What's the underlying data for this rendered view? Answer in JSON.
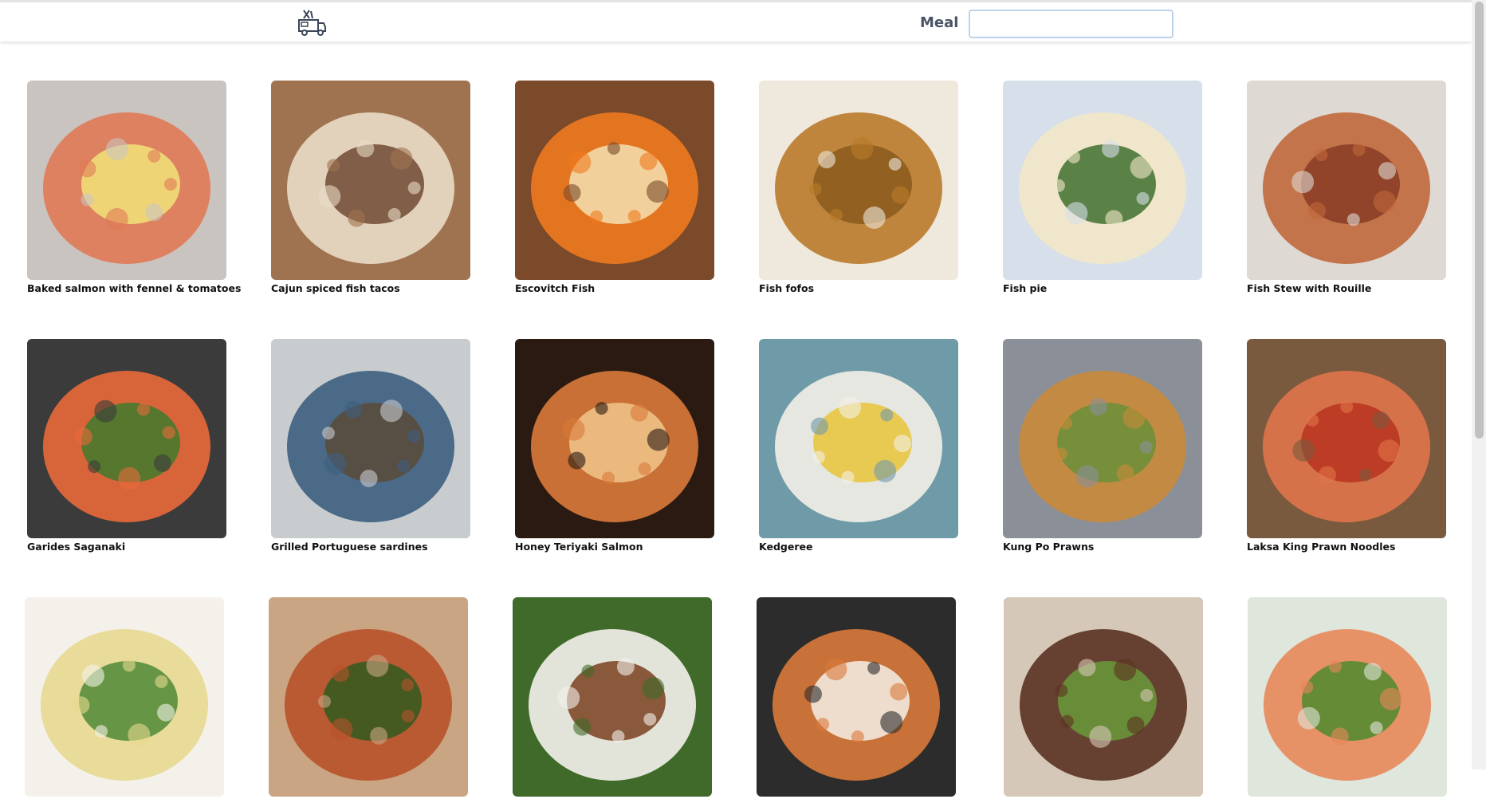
{
  "header": {
    "logo_icon": "food-truck-icon",
    "meal_label": "Meal",
    "meal_input_value": "",
    "meal_input_placeholder": ""
  },
  "colors": {
    "input_border": "#bcd3ec",
    "label": "#4a5466"
  },
  "meals": [
    {
      "name": "Baked salmon with fennel & tomatoes",
      "palette": [
        "#c9c4c0",
        "#e07a55",
        "#f2e37a"
      ]
    },
    {
      "name": "Cajun spiced fish tacos",
      "palette": [
        "#a07350",
        "#e9dcc6",
        "#6f4a34"
      ]
    },
    {
      "name": "Escovitch Fish",
      "palette": [
        "#7a4a2b",
        "#f07a1f",
        "#f3e0b2"
      ]
    },
    {
      "name": "Fish fofos",
      "palette": [
        "#efe8dd",
        "#b97a2a",
        "#8a5a1c"
      ]
    },
    {
      "name": "Fish pie",
      "palette": [
        "#d7e0ea",
        "#f2e7c8",
        "#3f6f2f"
      ]
    },
    {
      "name": "Fish Stew with Rouille",
      "palette": [
        "#ded9d3",
        "#c0683b",
        "#8a3c24"
      ]
    },
    {
      "name": "Garides Saganaki",
      "palette": [
        "#3b3b3b",
        "#ea6a3a",
        "#3f7a2c"
      ]
    },
    {
      "name": "Grilled Portuguese sardines",
      "palette": [
        "#c8ccce",
        "#3d5f80",
        "#5a4a38"
      ]
    },
    {
      "name": "Honey Teriyaki Salmon",
      "palette": [
        "#2a1a12",
        "#d97a3a",
        "#f1c48a"
      ]
    },
    {
      "name": "Kedgeree",
      "palette": [
        "#6f9aa8",
        "#f3f0e6",
        "#e7c43a"
      ]
    },
    {
      "name": "Kung Po Prawns",
      "palette": [
        "#8b8f97",
        "#c98a3a",
        "#6a8f3a"
      ]
    },
    {
      "name": "Laksa King Prawn Noodles",
      "palette": [
        "#7a5a3e",
        "#e0744a",
        "#b8321e"
      ]
    },
    {
      "name": "",
      "palette": [
        "#f3f1ea",
        "#e8d890",
        "#4f8a36"
      ]
    },
    {
      "name": "",
      "palette": [
        "#c9a583",
        "#b8522a",
        "#2f5a1f"
      ]
    },
    {
      "name": "",
      "palette": [
        "#3f6a2a",
        "#f4f2ec",
        "#7a3f1e"
      ]
    },
    {
      "name": "",
      "palette": [
        "#2c2c2c",
        "#d9793a",
        "#f4f0e8"
      ]
    },
    {
      "name": "",
      "palette": [
        "#d6c8b8",
        "#5a3222",
        "#6a9a3a"
      ]
    },
    {
      "name": "",
      "palette": [
        "#dfe6dc",
        "#e8875a",
        "#4f8a2e"
      ]
    }
  ]
}
